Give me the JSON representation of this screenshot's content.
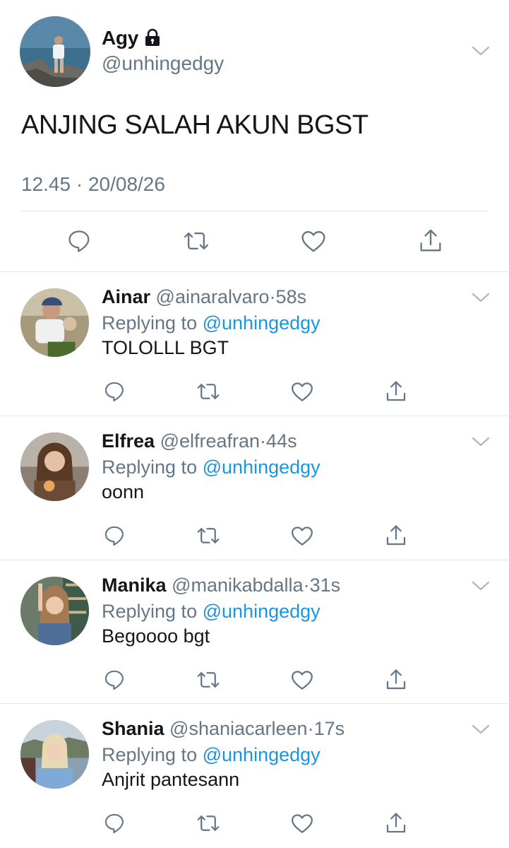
{
  "main_tweet": {
    "name": "Agy",
    "handle": "@unhingedgy",
    "text": "ANJING SALAH AKUN BGST",
    "meta": "12.45 · 20/08/26",
    "protected_icon": "lock-icon"
  },
  "actions": {
    "reply_icon": "reply-icon",
    "retweet_icon": "retweet-icon",
    "like_icon": "heart-icon",
    "share_icon": "share-icon"
  },
  "colors": {
    "link": "#1b95e0",
    "secondary_text": "#657786",
    "primary_text": "#14171a",
    "divider": "#e1e8ed"
  },
  "replies": [
    {
      "name": "Ainar",
      "handle": "@ainaralvaro",
      "time": "58s",
      "replying_prefix": "Replying to",
      "replying_to": "@unhingedgy",
      "text": "TOLOLLL BGT"
    },
    {
      "name": "Elfrea",
      "handle": "@elfreafran",
      "time": "44s",
      "replying_prefix": "Replying to",
      "replying_to": "@unhingedgy",
      "text": "oonn"
    },
    {
      "name": "Manika",
      "handle": "@manikabdalla",
      "time": "31s",
      "replying_prefix": "Replying to",
      "replying_to": "@unhingedgy",
      "text": "Begoooo bgt"
    },
    {
      "name": "Shania",
      "handle": "@shaniacarleen",
      "time": "17s",
      "replying_prefix": "Replying to",
      "replying_to": "@unhingedgy",
      "text": "Anjrit pantesann"
    }
  ]
}
